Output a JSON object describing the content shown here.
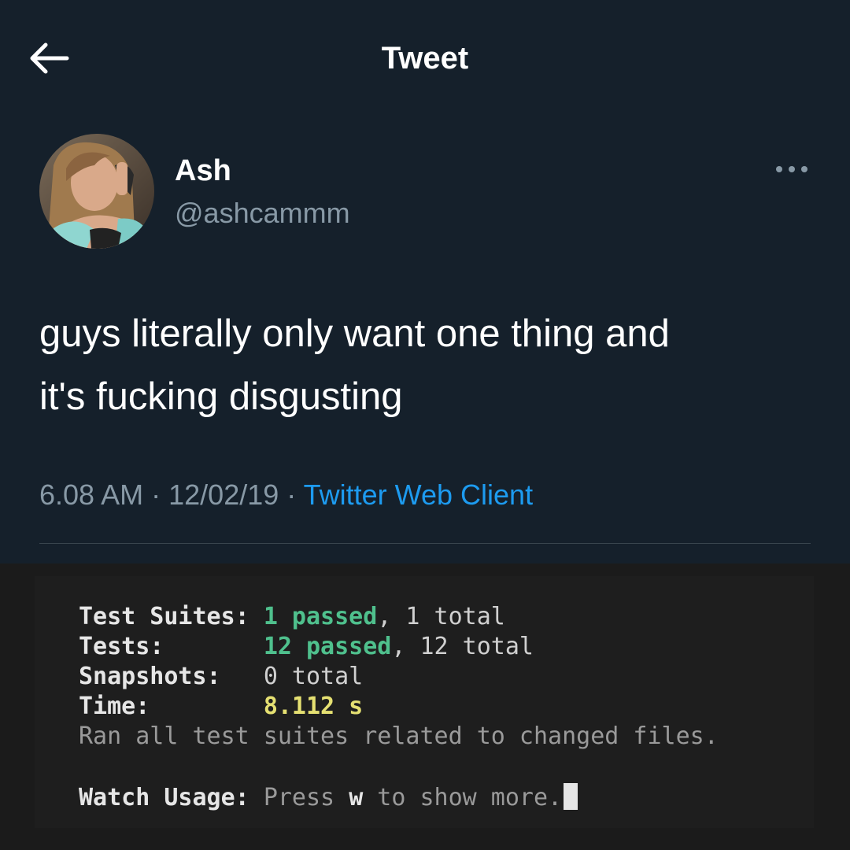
{
  "header": {
    "title": "Tweet",
    "back_icon": "arrow-left-icon"
  },
  "tweet": {
    "author": {
      "name": "Ash",
      "handle": "@ashcammm"
    },
    "text_lines": [
      "guys literally only want one thing and",
      "it's fucking disgusting"
    ],
    "time": "6.08 AM",
    "date": "12/02/19",
    "separator": "·",
    "client": "Twitter Web Client",
    "more_icon": "more-horizontal-icon"
  },
  "terminal": {
    "suites": {
      "label": "Test Suites:",
      "passed": "1 passed",
      "rest": ", 1 total"
    },
    "tests": {
      "label": "Tests:",
      "passed": "12 passed",
      "rest": ", 12 total"
    },
    "snapshots": {
      "label": "Snapshots:",
      "value": "0 total"
    },
    "time": {
      "label": "Time:",
      "value": "8.112 s"
    },
    "ran_line": "Ran all test suites related to changed files.",
    "watch": {
      "label": "Watch Usage:",
      "pre": "Press ",
      "key": "w",
      "post": " to show more."
    }
  },
  "colors": {
    "tweet_bg": "#15202b",
    "link": "#1d9bf0",
    "muted": "#8899a6",
    "terminal_green": "#4fc08d",
    "terminal_yellow": "#e5e072"
  }
}
